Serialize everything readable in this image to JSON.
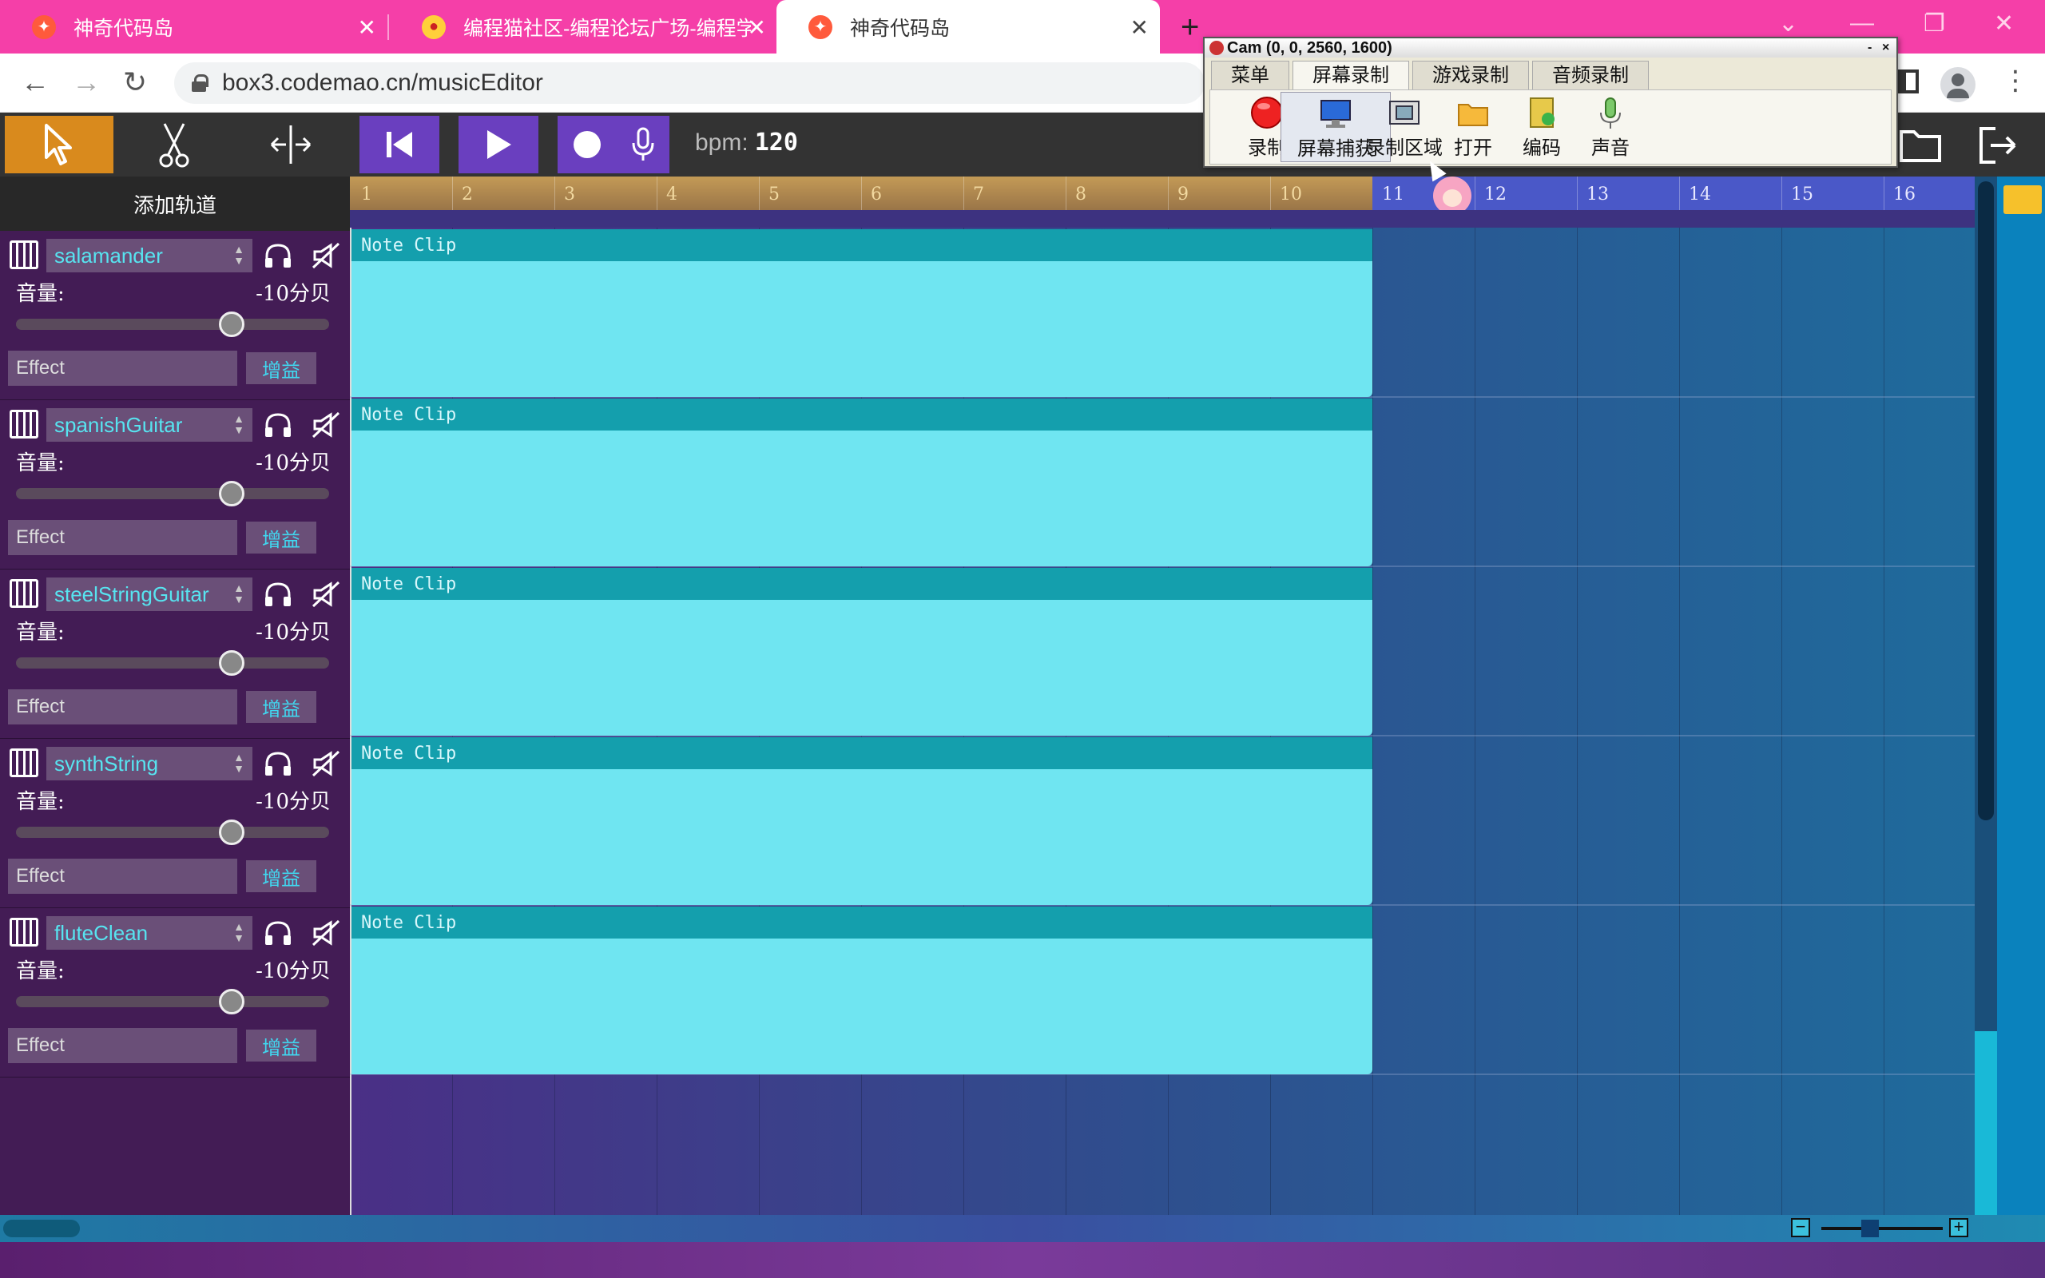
{
  "browser": {
    "tabs": [
      {
        "title": "神奇代码岛",
        "active": false
      },
      {
        "title": "编程猫社区-编程论坛广场-编程学",
        "active": false
      },
      {
        "title": "神奇代码岛",
        "active": true
      }
    ],
    "url": "box3.codemao.cn/musicEditor",
    "new_tab_label": "+"
  },
  "toolbar": {
    "bpm_label": "bpm:",
    "bpm_value": "120"
  },
  "left_panel": {
    "add_track_label": "添加轨道",
    "tracks": [
      {
        "instrument": "salamander",
        "volume_label": "音量:",
        "volume_value": "-10分贝",
        "effect_placeholder": "Effect",
        "gain_label": "增益",
        "volume_level": 0.69
      },
      {
        "instrument": "spanishGuitar",
        "volume_label": "音量:",
        "volume_value": "-10分贝",
        "effect_placeholder": "Effect",
        "gain_label": "增益",
        "volume_level": 0.69
      },
      {
        "instrument": "steelStringGuitar",
        "volume_label": "音量:",
        "volume_value": "-10分贝",
        "effect_placeholder": "Effect",
        "gain_label": "增益",
        "volume_level": 0.69
      },
      {
        "instrument": "synthString",
        "volume_label": "音量:",
        "volume_value": "-10分贝",
        "effect_placeholder": "Effect",
        "gain_label": "增益",
        "volume_level": 0.69
      },
      {
        "instrument": "fluteClean",
        "volume_label": "音量:",
        "volume_value": "-10分贝",
        "effect_placeholder": "Effect",
        "gain_label": "增益",
        "volume_level": 0.69
      }
    ]
  },
  "timeline": {
    "ruler_numbers": [
      "1",
      "2",
      "3",
      "4",
      "5",
      "6",
      "7",
      "8",
      "9",
      "10",
      "11",
      "12",
      "13",
      "14",
      "15",
      "16"
    ],
    "clip_label": "Note Clip",
    "clip_label_2": "Note Clip",
    "clip_label_3": "Note Clip",
    "clip_label_4": "Note Clip",
    "clip_label_5": "Note Clip"
  },
  "ocam": {
    "title": "Cam (0, 0, 2560, 1600)",
    "tabs": [
      "菜单",
      "屏幕录制",
      "游戏录制",
      "音频录制"
    ],
    "buttons": [
      "录制",
      "屏幕捕获",
      "录制区域",
      "打开",
      "编码",
      "声音"
    ]
  },
  "colors": {
    "tab_bar": "#f53fa8",
    "select_tool": "#d98a1d",
    "transport": "#6a3fbf",
    "clip_body": "#6fe5f1",
    "clip_header": "#149fad"
  }
}
